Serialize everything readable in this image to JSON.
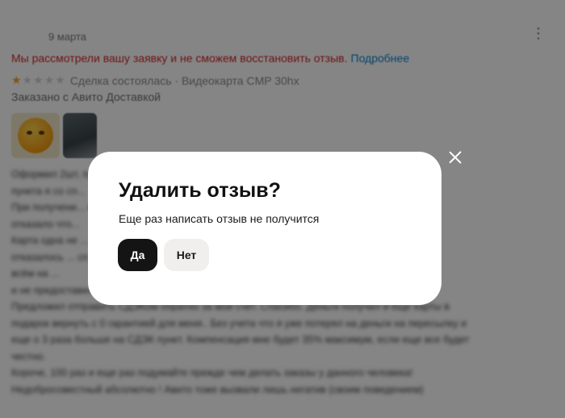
{
  "review": {
    "date": "9 марта",
    "status_text": "Мы рассмотрели вашу заявку и не сможем восстановить отзыв.",
    "status_link": "Подробнее",
    "rating": 1,
    "rating_max": 5,
    "deal_line": "Сделка состоялась · Видеокарта CMP 30hx",
    "delivery_line": "Заказано с Авито Доставкой",
    "more_icon": "⋮",
    "body_lines": [
      "Оформил 2шт, пришли обе ... ствнно ко за этого",
      "пункта я со сп...",
      "При получени... нет. Авито",
      "отказало что...",
      "Карта одна не ...",
      "отказалось ... сп...",
      "всём на ...",
      "и не предоставили.",
      "Предложил отправить СДЭКом обратно за мои счет. Спасибо. Деньги получил и еще карты в",
      "подарок вернуть с 0 гарантией для меня.. Без учета что я уже потерял на деньги на пересылку и",
      "еще о 3 раза больше на СДЭК пункт. Компенсация мне будет 35% максимум, если еще все будет",
      "честно.",
      "Короче, 100 раз и еще раз подумайте прежде чем делать заказы у данного человека!",
      "Недобросовестный абсолютно ! Авито тоже вызвали лишь негатив (своим поведением)"
    ]
  },
  "dialog": {
    "title": "Удалить отзыв?",
    "text": "Еще раз написать отзыв не получится",
    "yes_label": "Да",
    "no_label": "Нет"
  },
  "colors": {
    "status_red": "#d8232a",
    "link_blue": "#0a84d4",
    "star_active": "#f5a623",
    "primary_button": "#141414"
  }
}
